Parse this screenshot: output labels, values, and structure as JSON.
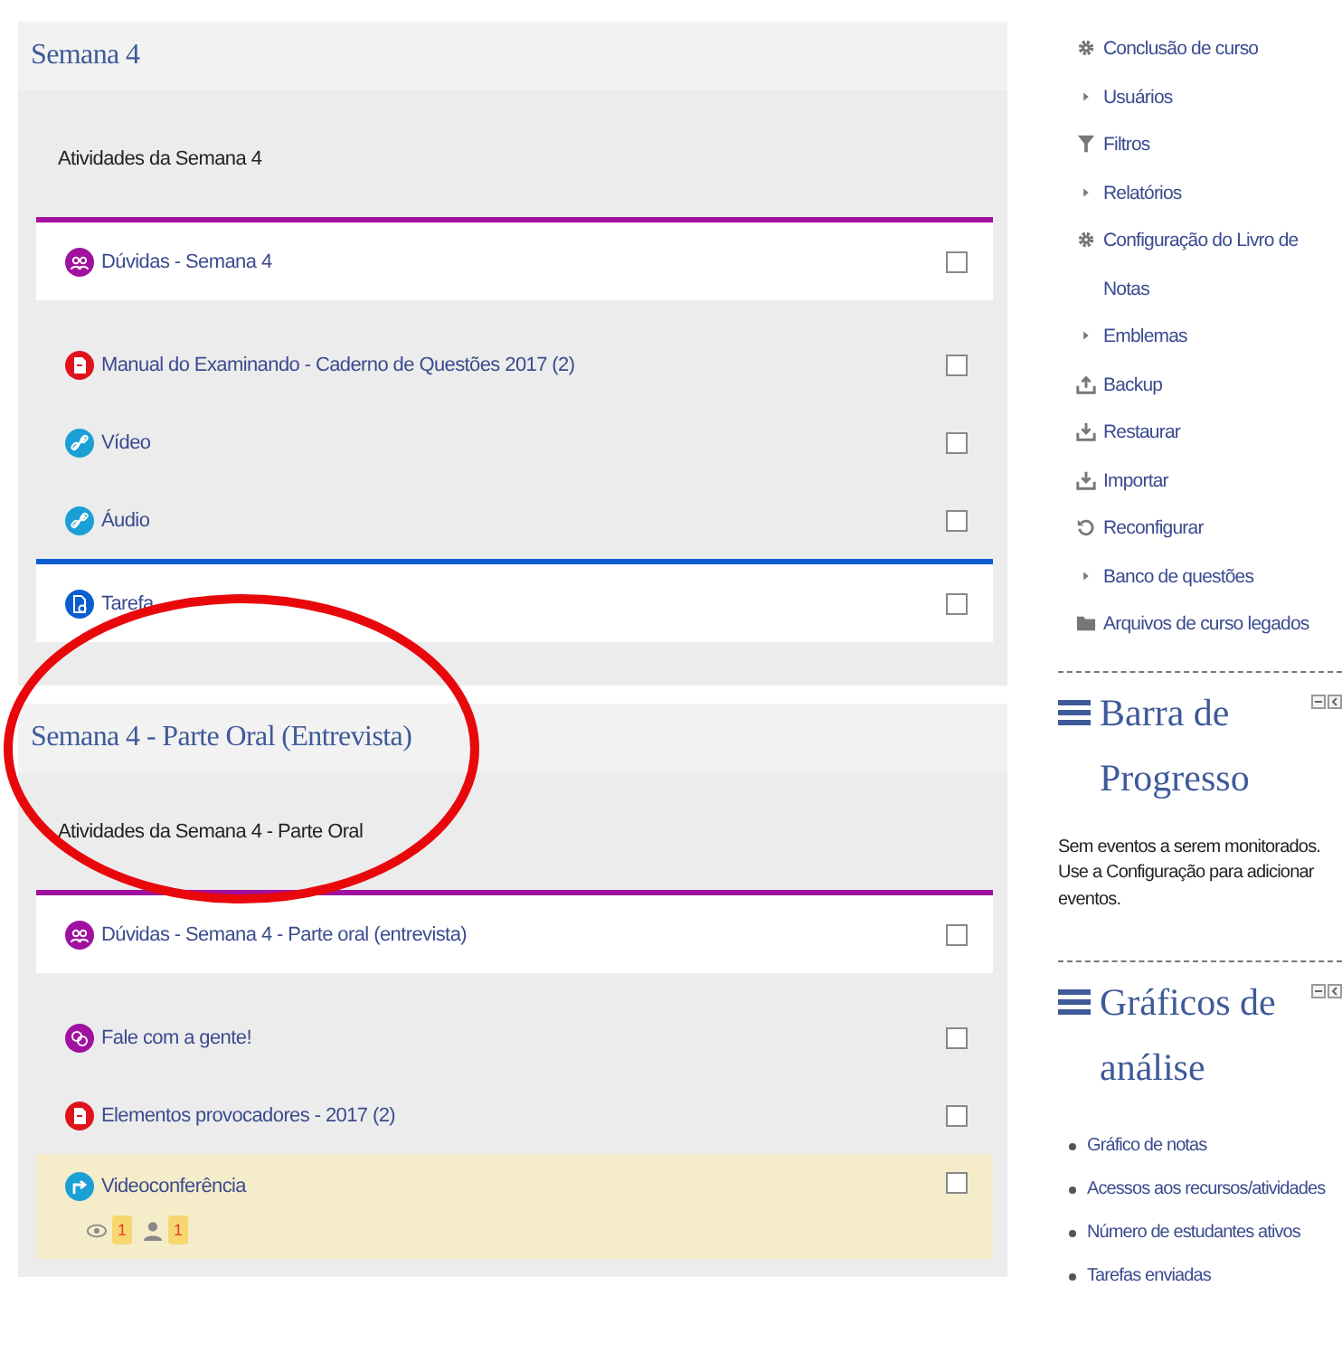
{
  "sections": [
    {
      "title": "Semana 4",
      "summary": "Atividades da Semana 4",
      "activities": [
        {
          "kind": "forum",
          "name": "Dúvidas - Semana 4",
          "color": "#a0119f",
          "highlighted": false,
          "completed": false
        },
        {
          "kind": "pdf",
          "name": "Manual do Examinando - Caderno de Questões 2017 (2)",
          "highlighted": false,
          "completed": false
        },
        {
          "kind": "url",
          "name": "Vídeo",
          "highlighted": false,
          "completed": false
        },
        {
          "kind": "url",
          "name": "Áudio",
          "highlighted": false,
          "completed": false
        },
        {
          "kind": "assign",
          "name": "Tarefa",
          "color": "#0b5ed0",
          "highlighted": false,
          "completed": false
        }
      ]
    },
    {
      "title": "Semana 4 - Parte Oral (Entrevista)",
      "summary": "Atividades da Semana 4 - Parte Oral",
      "activities": [
        {
          "kind": "forum",
          "name": "Dúvidas - Semana 4 - Parte oral (entrevista)",
          "color": "#a0119f",
          "highlighted": false,
          "completed": false
        },
        {
          "kind": "chat",
          "name": "Fale com a gente!",
          "highlighted": false,
          "completed": false
        },
        {
          "kind": "pdf",
          "name": "Elementos provocadores - 2017 (2)",
          "highlighted": false,
          "completed": false
        },
        {
          "kind": "videoconf",
          "name": "Videoconferência",
          "highlighted": true,
          "completed": false,
          "views": "1",
          "users": "1"
        }
      ]
    }
  ],
  "admin_menu": [
    {
      "kind": "gear",
      "label": "Conclusão de curso"
    },
    {
      "kind": "caret",
      "label": "Usuários"
    },
    {
      "kind": "filter",
      "label": "Filtros"
    },
    {
      "kind": "caret",
      "label": "Relatórios"
    },
    {
      "kind": "gear",
      "label": "Configuração do Livro de Notas"
    },
    {
      "kind": "caret",
      "label": "Emblemas"
    },
    {
      "kind": "upload",
      "label": "Backup"
    },
    {
      "kind": "download",
      "label": "Restaurar"
    },
    {
      "kind": "download",
      "label": "Importar"
    },
    {
      "kind": "reload",
      "label": "Reconfigurar"
    },
    {
      "kind": "caret",
      "label": "Banco de questões"
    },
    {
      "kind": "folder",
      "label": "Arquivos de curso legados"
    }
  ],
  "blocks": [
    {
      "title": "Barra de Progresso",
      "text": "Sem eventos a serem monitorados. Use a Configuração para adicionar eventos."
    },
    {
      "title": "Gráficos de análise",
      "links": [
        "Gráfico de notas",
        "Acessos aos recursos/atividades",
        "Número de estudantes ativos",
        "Tarefas enviadas"
      ]
    }
  ]
}
